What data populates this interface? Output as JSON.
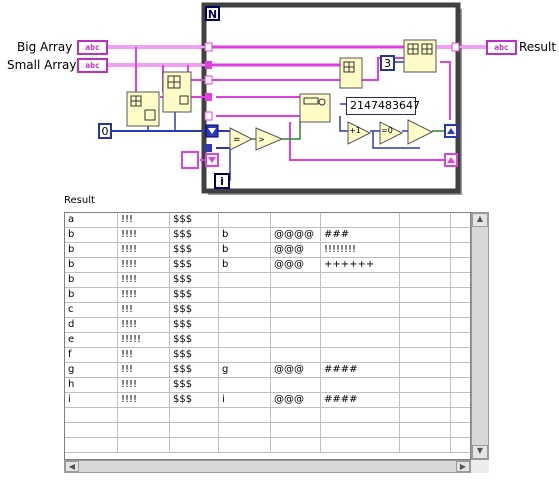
{
  "diagram": {
    "controls": {
      "big_array_label": "Big Array",
      "small_array_label": "Small Array",
      "result_label": "Result",
      "terminal_text": "abc"
    },
    "loop": {
      "count_terminal": "N",
      "iteration_terminal": "i"
    },
    "constants": {
      "zero": "0",
      "three": "3",
      "max_int": "2147483647",
      "increment": "+1",
      "equals_zero": "=0"
    },
    "colors": {
      "string_wire": "#e040e0",
      "numeric_wire": "#2a3ab8",
      "boolean_wire": "#2a8a2a",
      "node_fill": "#fffcc8",
      "loop_border": "#333333"
    }
  },
  "table": {
    "label": "Result",
    "rows": [
      [
        "a",
        "!!!",
        "$$$",
        "",
        "",
        "",
        "",
        ""
      ],
      [
        "b",
        "!!!!",
        "$$$",
        "b",
        "@@@@",
        "###",
        "",
        ""
      ],
      [
        "b",
        "!!!!",
        "$$$",
        "b",
        "@@@",
        "!!!!!!!!",
        "",
        ""
      ],
      [
        "b",
        "!!!!",
        "$$$",
        "b",
        "@@@",
        "++++++",
        "",
        ""
      ],
      [
        "b",
        "!!!!",
        "$$$",
        "",
        "",
        "",
        "",
        ""
      ],
      [
        "b",
        "!!!!",
        "$$$",
        "",
        "",
        "",
        "",
        ""
      ],
      [
        "c",
        "!!!",
        "$$$",
        "",
        "",
        "",
        "",
        ""
      ],
      [
        "d",
        "!!!!",
        "$$$",
        "",
        "",
        "",
        "",
        ""
      ],
      [
        "e",
        "!!!!!",
        "$$$",
        "",
        "",
        "",
        "",
        ""
      ],
      [
        "f",
        "!!!",
        "$$$",
        "",
        "",
        "",
        "",
        ""
      ],
      [
        "g",
        "!!!",
        "$$$",
        "g",
        "@@@",
        "####",
        "",
        ""
      ],
      [
        "h",
        "!!!!",
        "$$$",
        "",
        "",
        "",
        "",
        ""
      ],
      [
        "i",
        "!!!!",
        "$$$",
        "i",
        "@@@",
        "####",
        "",
        ""
      ],
      [
        "",
        "",
        "",
        "",
        "",
        "",
        "",
        ""
      ],
      [
        "",
        "",
        "",
        "",
        "",
        "",
        "",
        ""
      ],
      [
        "",
        "",
        "",
        "",
        "",
        "",
        "",
        ""
      ]
    ]
  }
}
